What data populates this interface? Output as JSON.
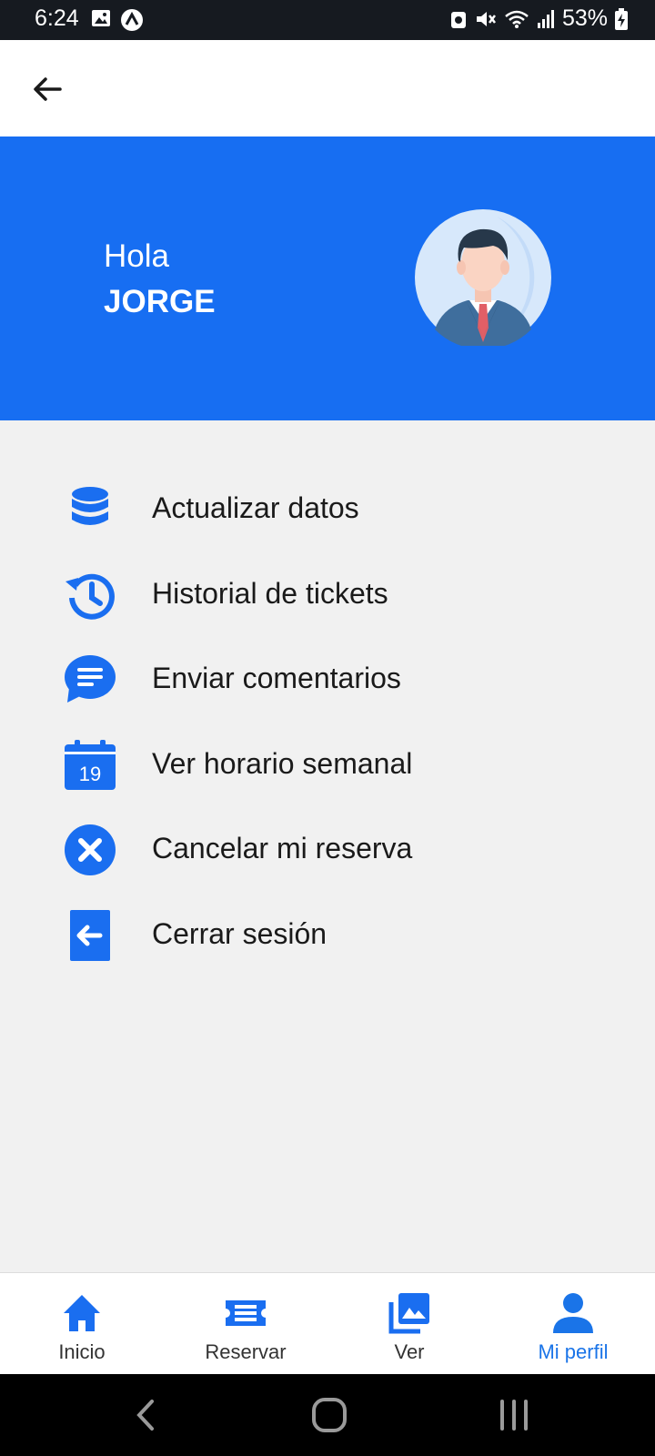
{
  "status_bar": {
    "time": "6:24",
    "battery": "53%"
  },
  "header": {
    "back_icon": "arrow-left-icon"
  },
  "hero": {
    "greeting": "Hola",
    "username": "JORGE",
    "avatar_icon": "businessman-avatar",
    "background_color": "#176EF2"
  },
  "menu": {
    "items": [
      {
        "label": "Actualizar datos",
        "icon": "database-icon"
      },
      {
        "label": "Historial de tickets",
        "icon": "history-icon"
      },
      {
        "label": "Enviar comentarios",
        "icon": "comment-icon"
      },
      {
        "label": "Ver horario semanal",
        "icon": "calendar-icon",
        "calendar_day": "19"
      },
      {
        "label": "Cancelar mi reserva",
        "icon": "cancel-icon"
      },
      {
        "label": "Cerrar sesión",
        "icon": "logout-icon"
      }
    ]
  },
  "bottom_nav": {
    "items": [
      {
        "label": "Inicio",
        "icon": "home-icon",
        "active": false
      },
      {
        "label": "Reservar",
        "icon": "ticket-icon",
        "active": false
      },
      {
        "label": "Ver",
        "icon": "gallery-icon",
        "active": false
      },
      {
        "label": "Mi perfil",
        "icon": "person-icon",
        "active": true
      }
    ],
    "active_color": "#1A74E8"
  },
  "colors": {
    "accent": "#176EF2",
    "icon_blue": "#1A6EF0",
    "background": "#F1F1F1"
  }
}
